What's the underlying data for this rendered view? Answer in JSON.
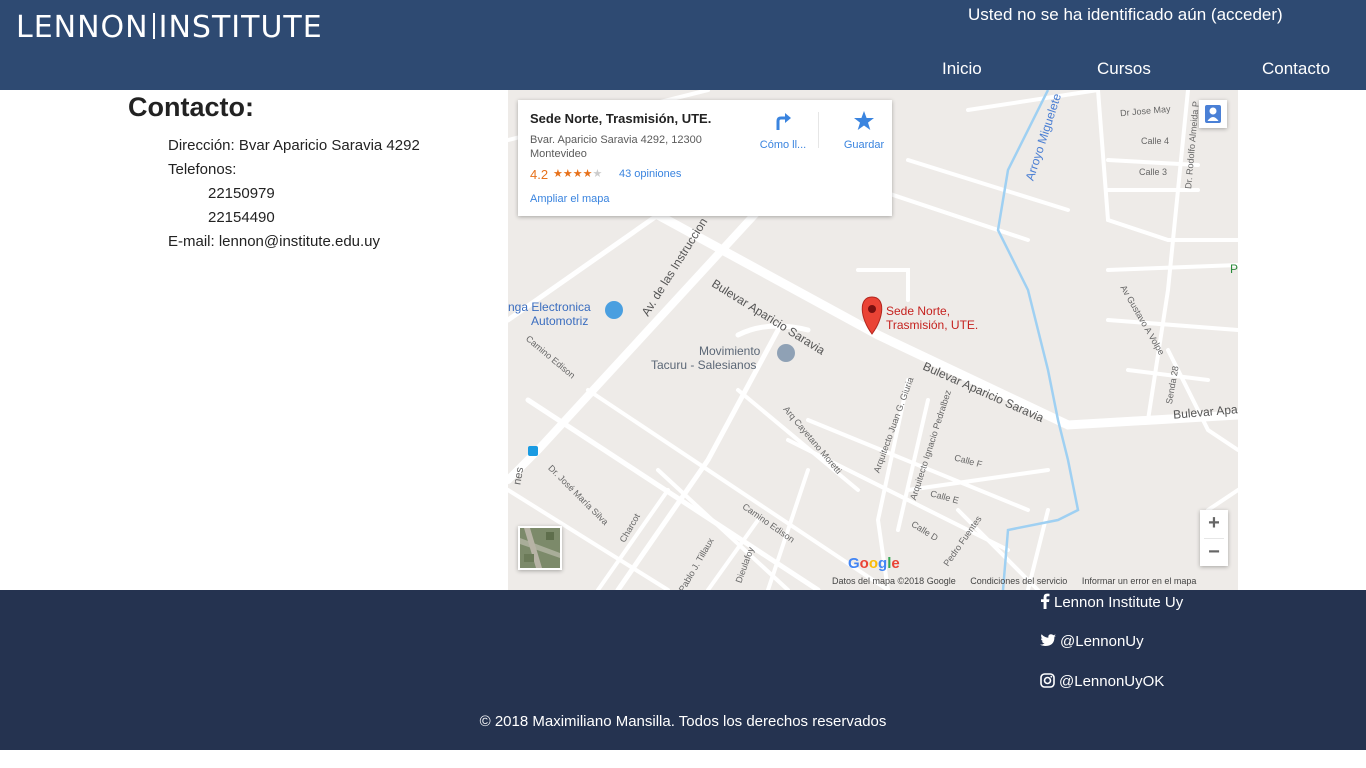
{
  "header": {
    "logo_left": "LENNON",
    "logo_right": "INSTITUTE",
    "login_text": "Usted no se ha identificado aún",
    "login_link": "(acceder)",
    "nav": [
      {
        "label": "Inicio"
      },
      {
        "label": "Cursos"
      },
      {
        "label": "Contacto"
      }
    ]
  },
  "contact": {
    "title": "Contacto:",
    "address_label": "Dirección:",
    "address": "Bvar Aparicio Saravia 4292",
    "phones_label": "Telefonos:",
    "phones": [
      "22150979",
      "22154490"
    ],
    "email_label": "E-mail:",
    "email": "lennon@institute.edu.uy"
  },
  "map": {
    "card": {
      "title": "Sede Norte, Trasmisión, UTE.",
      "address": "Bvar. Aparicio Saravia 4292, 12300 Montevideo",
      "rating": "4.2",
      "rating_value": 4.2,
      "reviews": "43 opiniones",
      "directions_label": "Cómo ll...",
      "save_label": "Guardar",
      "enlarge_label": "Ampliar el mapa"
    },
    "marker_label_1": "Sede Norte,",
    "marker_label_2": "Trasmisión, UTE.",
    "streets": {
      "aparicio_1": "Bulevar Aparicio Saravia",
      "aparicio_2": "Bulevar Aparicio Saravia",
      "aparicio_3": "Bulevar Apa",
      "instrucciones": "Av. de las Instruccion",
      "arroyo": "Arroyo Miguelete",
      "edison_1": "Camino Edison",
      "edison_2": "Camino Edison",
      "moretti": "Arq Cayetano Moretti",
      "giuria": "Arquitecto Juan G. Giuria",
      "pedralbez": "Arquitecto Ignacio Pedralbez",
      "calle_f": "Calle F",
      "calle_e": "Calle E",
      "calle_d": "Calle D",
      "pedro_fuentes": "Pedro Fuentes",
      "jose_maria_silva": "Dr. José María Silva",
      "charcot": "Charcot",
      "tillaux": "Pablo J. Tillaux",
      "dieulafoy": "Dieulafoy",
      "volpe": "Av Gustavo A Volpe",
      "senda": "Senda 28",
      "jose_may": "Dr Jose May",
      "almeida": "Dr. Rodolfo Almeida P",
      "calle_4": "Calle 4",
      "calle_3": "Calle 3",
      "bus_nes": "nes"
    },
    "pois": {
      "electronica_1": "nga Electronica",
      "electronica_2": "Automotriz",
      "movimiento_1": "Movimiento",
      "movimiento_2": "Tacuru - Salesianos",
      "p": "P"
    },
    "google_letters": [
      "G",
      "o",
      "o",
      "g",
      "l",
      "e"
    ],
    "attribution": {
      "data": "Datos del mapa ©2018 Google",
      "terms": "Condiciones del servicio",
      "report": "Informar un error en el mapa"
    },
    "zoom_in": "+",
    "zoom_out": "−"
  },
  "footer": {
    "facebook": "Lennon Institute Uy",
    "twitter": "@LennonUy",
    "instagram": "@LennonUyOK",
    "copyright": "© 2018 Maximiliano Mansilla. Todos los derechos reservados"
  },
  "colors": {
    "header_bg": "#2e4a72",
    "footer_bg": "#253350",
    "link_blue": "#3a84df",
    "marker_red": "#ea4335"
  }
}
